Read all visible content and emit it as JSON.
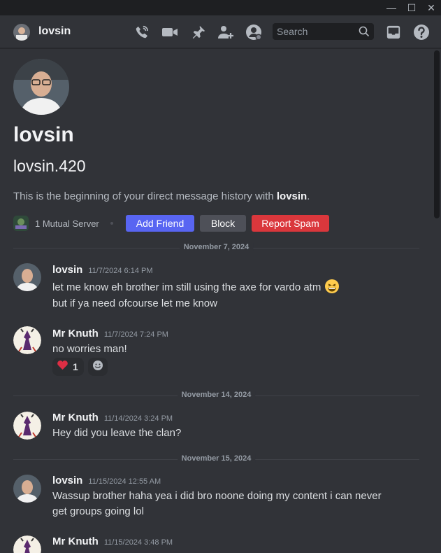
{
  "header": {
    "name": "lovsin",
    "search_placeholder": "Search",
    "icons": [
      "voice-call-icon",
      "video-call-icon",
      "pinned-messages-icon",
      "add-friends-to-dm-icon",
      "user-profile-icon",
      "inbox-icon",
      "help-icon"
    ]
  },
  "window": {
    "minimize": "—",
    "maximize": "☐",
    "close": "✕"
  },
  "profile": {
    "display_name": "lovsin",
    "username": "lovsin.420",
    "intro_prefix": "This is the beginning of your direct message history with ",
    "intro_name": "lovsin",
    "intro_suffix": ".",
    "mutual_servers": "1 Mutual Server",
    "buttons": {
      "add_friend": "Add Friend",
      "block": "Block",
      "report_spam": "Report Spam"
    }
  },
  "dividers": [
    "November 7, 2024",
    "November 14, 2024",
    "November 15, 2024"
  ],
  "messages": [
    {
      "author": "lovsin",
      "time": "11/7/2024 6:14 PM",
      "lines": [
        "let me know eh brother im still using the axe for vardo atm",
        "but if ya need ofcourse let me know"
      ]
    },
    {
      "author": "Mr Knuth",
      "time": "11/7/2024 7:24 PM",
      "lines": [
        "no worries man!"
      ],
      "reaction": {
        "emoji": "❤",
        "count": "1"
      }
    },
    {
      "author": "Mr Knuth",
      "time": "11/14/2024 3:24 PM",
      "lines": [
        "Hey did you leave the clan?"
      ]
    },
    {
      "author": "lovsin",
      "time": "11/15/2024 12:55 AM",
      "lines": [
        "Wassup brother haha yea i did bro noone doing my content i can never",
        "get groups going lol"
      ]
    },
    {
      "author": "Mr Knuth",
      "time": "11/15/2024 3:48 PM",
      "lines": []
    }
  ],
  "colors": {
    "background": "#313338",
    "blurple": "#5865f2",
    "danger": "#da373c",
    "secondary": "#4e5058"
  }
}
